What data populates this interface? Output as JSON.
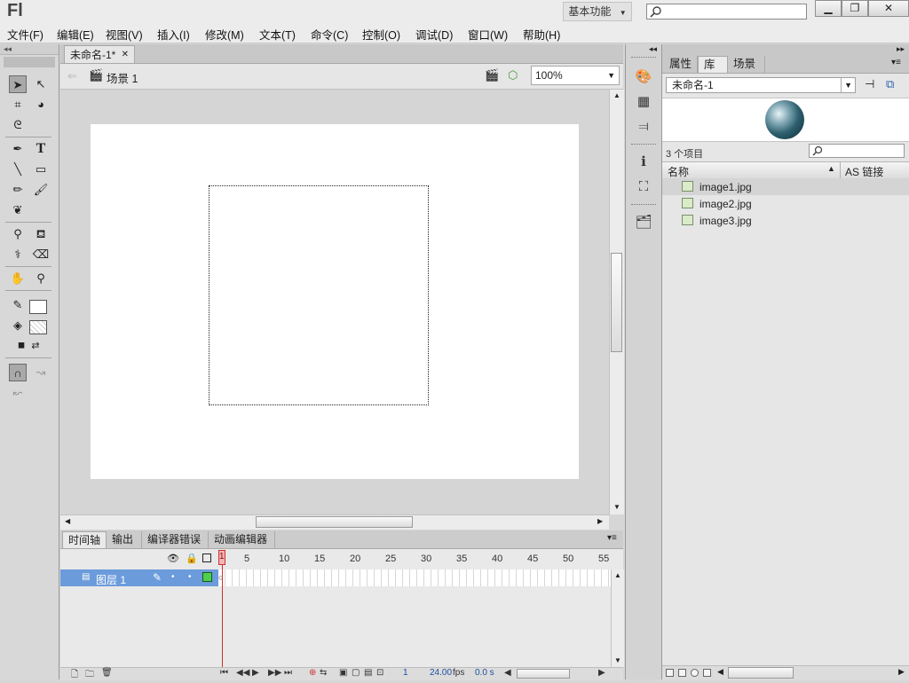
{
  "app": {
    "logo": "Fl",
    "workspace_label": "基本功能",
    "window_buttons": [
      "minimize-icon",
      "maximize-icon",
      "close-icon"
    ]
  },
  "menu": [
    "文件(F)",
    "编辑(E)",
    "视图(V)",
    "插入(I)",
    "修改(M)",
    "文本(T)",
    "命令(C)",
    "控制(O)",
    "调试(D)",
    "窗口(W)",
    "帮助(H)"
  ],
  "document": {
    "tab_label": "未命名-1*",
    "scene_label": "场景 1",
    "zoom": "100%"
  },
  "timeline": {
    "tabs": [
      "时间轴",
      "输出",
      "编译器错误",
      "动画编辑器"
    ],
    "ruler_marks": [
      "1",
      "5",
      "10",
      "15",
      "20",
      "25",
      "30",
      "35",
      "40",
      "45",
      "50",
      "55"
    ],
    "layer_name": "图层 1",
    "current_frame": "1",
    "fps": "24.00",
    "fps_unit": "fps",
    "time": "0.0 s"
  },
  "library": {
    "tabs": [
      "属性",
      "库",
      "场景"
    ],
    "active_tab": "库",
    "document_select": "未命名-1",
    "item_count": "3 个项目",
    "columns": [
      "名称",
      "AS 链接"
    ],
    "items": [
      "image1.jpg",
      "image2.jpg",
      "image3.jpg"
    ]
  },
  "colors": {
    "layer_selected": "#6b9bdb",
    "stage": "#ffffff",
    "playhead": "#d32f2f"
  }
}
